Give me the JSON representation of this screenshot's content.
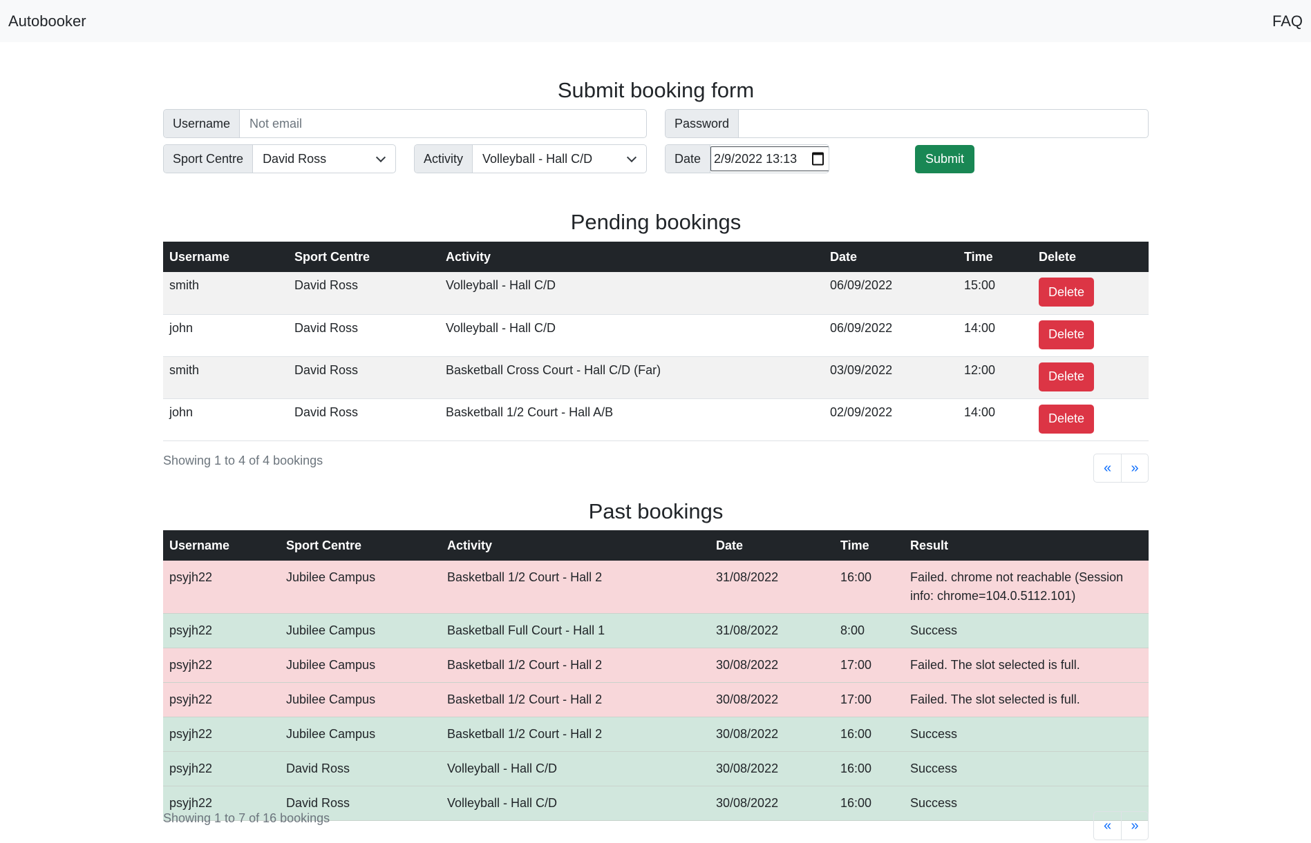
{
  "navbar": {
    "brand": "Autobooker",
    "faq": "FAQ"
  },
  "form": {
    "title": "Submit booking form",
    "username_label": "Username",
    "username_placeholder": "Not email",
    "password_label": "Password",
    "password_value": "",
    "sport_centre_label": "Sport Centre",
    "sport_centre_value": "David Ross",
    "activity_label": "Activity",
    "activity_value": "Volleyball - Hall C/D",
    "date_label": "Date",
    "date_value": "2/9/2022 13:13",
    "submit_label": "Submit"
  },
  "pending": {
    "title": "Pending bookings",
    "headers": [
      "Username",
      "Sport Centre",
      "Activity",
      "Date",
      "Time",
      "Delete"
    ],
    "rows": [
      {
        "username": "smith",
        "centre": "David Ross",
        "activity": "Volleyball - Hall C/D",
        "date": "06/09/2022",
        "time": "15:00",
        "delete": "Delete"
      },
      {
        "username": "john",
        "centre": "David Ross",
        "activity": "Volleyball - Hall C/D",
        "date": "06/09/2022",
        "time": "14:00",
        "delete": "Delete"
      },
      {
        "username": "smith",
        "centre": "David Ross",
        "activity": "Basketball Cross Court - Hall C/D (Far)",
        "date": "03/09/2022",
        "time": "12:00",
        "delete": "Delete"
      },
      {
        "username": "john",
        "centre": "David Ross",
        "activity": "Basketball 1/2 Court - Hall A/B",
        "date": "02/09/2022",
        "time": "14:00",
        "delete": "Delete"
      }
    ],
    "showing": "Showing 1 to 4 of 4 bookings",
    "prev": "«",
    "next": "»"
  },
  "past": {
    "title": "Past bookings",
    "headers": [
      "Username",
      "Sport Centre",
      "Activity",
      "Date",
      "Time",
      "Result"
    ],
    "rows": [
      {
        "username": "psyjh22",
        "centre": "Jubilee Campus",
        "activity": "Basketball 1/2 Court - Hall 2",
        "date": "31/08/2022",
        "time": "16:00",
        "result": "Failed. chrome not reachable (Session info: chrome=104.0.5112.101)",
        "status": "failed"
      },
      {
        "username": "psyjh22",
        "centre": "Jubilee Campus",
        "activity": "Basketball Full Court - Hall 1",
        "date": "31/08/2022",
        "time": "8:00",
        "result": "Success",
        "status": "success"
      },
      {
        "username": "psyjh22",
        "centre": "Jubilee Campus",
        "activity": "Basketball 1/2 Court - Hall 2",
        "date": "30/08/2022",
        "time": "17:00",
        "result": "Failed. The slot selected is full.",
        "status": "failed"
      },
      {
        "username": "psyjh22",
        "centre": "Jubilee Campus",
        "activity": "Basketball 1/2 Court - Hall 2",
        "date": "30/08/2022",
        "time": "17:00",
        "result": "Failed. The slot selected is full.",
        "status": "failed"
      },
      {
        "username": "psyjh22",
        "centre": "Jubilee Campus",
        "activity": "Basketball 1/2 Court - Hall 2",
        "date": "30/08/2022",
        "time": "16:00",
        "result": "Success",
        "status": "success"
      },
      {
        "username": "psyjh22",
        "centre": "David Ross",
        "activity": "Volleyball - Hall C/D",
        "date": "30/08/2022",
        "time": "16:00",
        "result": "Success",
        "status": "success"
      },
      {
        "username": "psyjh22",
        "centre": "David Ross",
        "activity": "Volleyball - Hall C/D",
        "date": "30/08/2022",
        "time": "16:00",
        "result": "Success",
        "status": "success"
      }
    ],
    "showing": "Showing 1 to 7 of 16 bookings",
    "prev": "«",
    "next": "»"
  },
  "colors": {
    "success_button": "#198754",
    "danger_button": "#dc3545",
    "failed_row": "#f8d7da",
    "success_row": "#d1e7dd",
    "table_header": "#212529",
    "link": "#0d6efd"
  }
}
